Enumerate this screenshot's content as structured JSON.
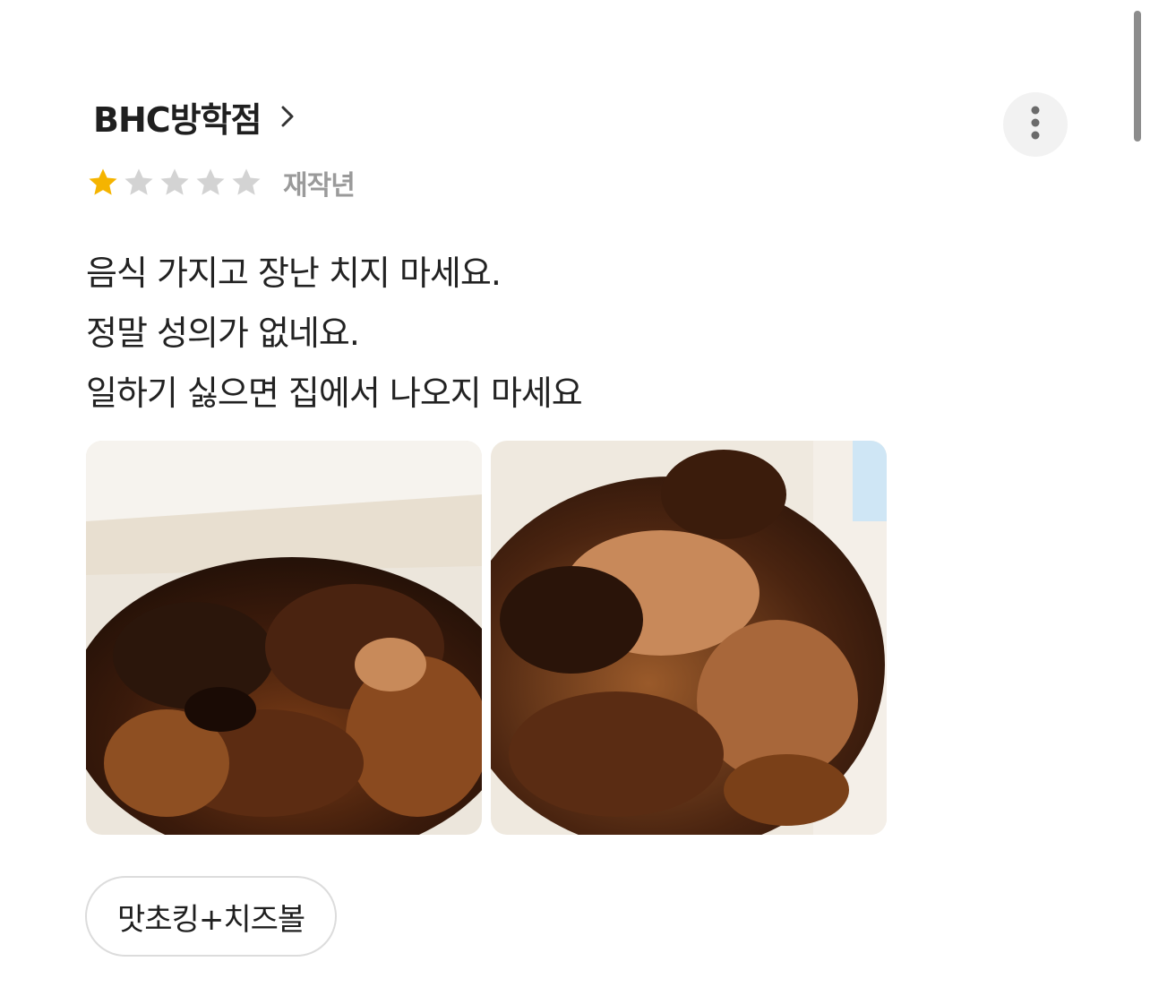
{
  "review": {
    "store_name": "BHC방학점",
    "chevron_icon": "chevron-right-icon",
    "more_icon": "more-vertical-icon",
    "rating": 1,
    "rating_max": 5,
    "star_filled_color": "#f5b400",
    "star_empty_color": "#d3d3d3",
    "author": "재작년",
    "lines": [
      "음식 가지고 장난 치지 마세요.",
      "정말 성의가 없네요.",
      "일하기 싫으면 집에서 나오지 마세요"
    ],
    "photos": [
      {
        "icon": "food-photo"
      },
      {
        "icon": "food-photo"
      }
    ],
    "menu_chip": "맛초킹+치즈볼"
  }
}
